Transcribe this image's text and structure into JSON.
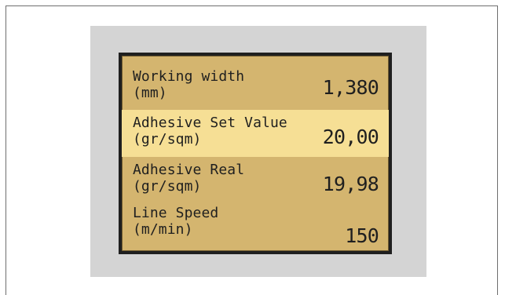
{
  "panel": {
    "rows": [
      {
        "label_line1": "Working width",
        "label_line2": "(mm)",
        "value": "1,380",
        "highlighted": false
      },
      {
        "label_line1": "Adhesive Set Value",
        "label_line2": "(gr/sqm)",
        "value": "20,00",
        "highlighted": true
      },
      {
        "label_line1": "Adhesive Real",
        "label_line2": "(gr/sqm)",
        "value": "19,98",
        "highlighted": false
      },
      {
        "label_line1": "Line Speed",
        "label_line2": "(m/min)",
        "value": "150",
        "highlighted": false
      }
    ]
  },
  "colors": {
    "screen_background": "#d4b56f",
    "highlight_background": "#f6df95",
    "text": "#1f1f1f",
    "bezel": "#d4d4d4",
    "frame_border": "#6f6f6f"
  }
}
